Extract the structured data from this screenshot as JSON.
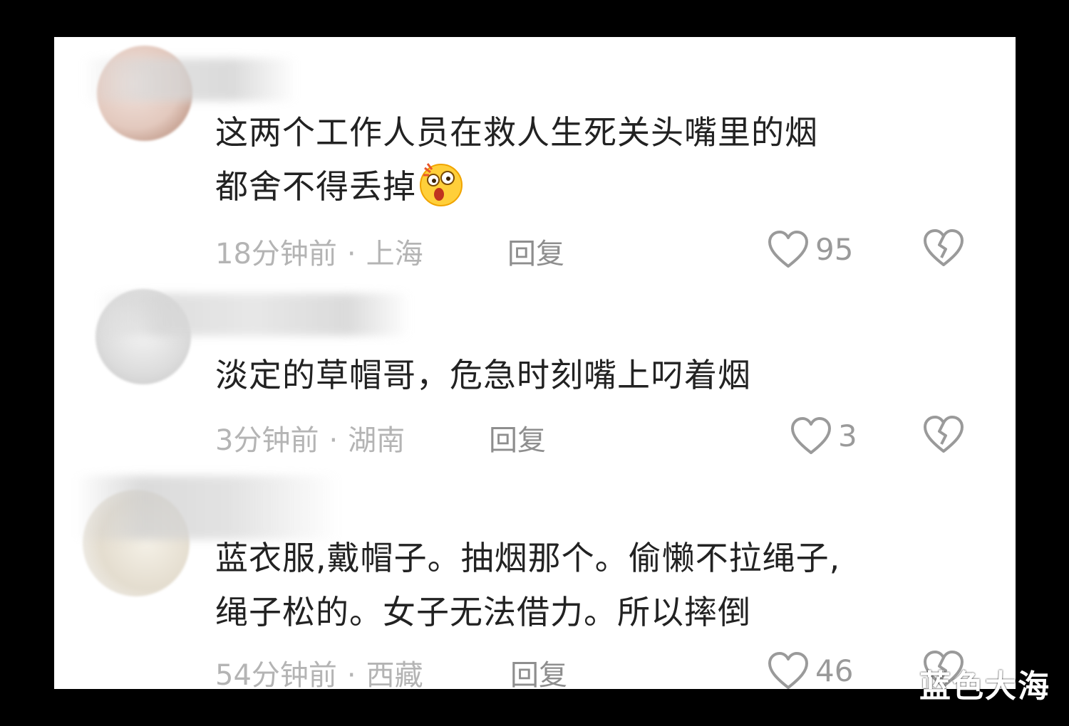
{
  "comments": [
    {
      "text_line1": "这两个工作人员在救人生死关头嘴里的烟",
      "text_line2": "都舍不得丢掉",
      "emoji": "astonished-face-emoji",
      "time": "18分钟前",
      "location": "上海",
      "reply_label": "回复",
      "likes": "95",
      "avatar_colors": [
        "#e9d6cf",
        "#b98974"
      ]
    },
    {
      "text_line1": "淡定的草帽哥，危急时刻嘴上叼着烟",
      "time": "3分钟前",
      "location": "湖南",
      "reply_label": "回复",
      "likes": "3",
      "avatar_colors": [
        "#ebebeb",
        "#cfcfcf"
      ]
    },
    {
      "text_line1": "蓝衣服,戴帽子。抽烟那个。偷懒不拉绳子,",
      "text_line2": "绳子松的。女子无法借力。所以摔倒",
      "time": "54分钟前",
      "location": "西藏",
      "reply_label": "回复",
      "likes": "46",
      "avatar_colors": [
        "#ededed",
        "#d9d2c4"
      ]
    }
  ],
  "separator": "·",
  "icons": {
    "like": "heart-outline-icon",
    "dislike": "broken-heart-icon"
  },
  "watermark": "蓝色大海"
}
